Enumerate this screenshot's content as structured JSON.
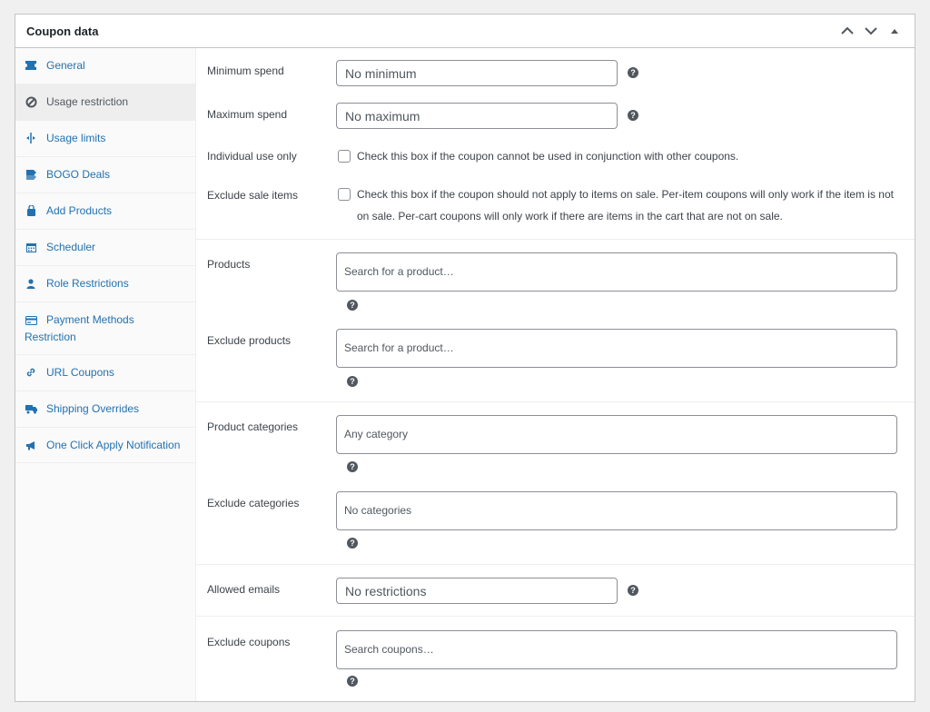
{
  "metabox": {
    "title": "Coupon data"
  },
  "tabs": [
    {
      "label": "General",
      "icon": "ticket-icon"
    },
    {
      "label": "Usage restriction",
      "icon": "prohibited-icon"
    },
    {
      "label": "Usage limits",
      "icon": "arrows-limit-icon"
    },
    {
      "label": "BOGO Deals",
      "icon": "bogo-icon"
    },
    {
      "label": "Add Products",
      "icon": "bag-icon"
    },
    {
      "label": "Scheduler",
      "icon": "calendar-icon"
    },
    {
      "label": "Role Restrictions",
      "icon": "user-icon"
    },
    {
      "label": "Payment Methods Restriction",
      "icon": "credit-card-icon"
    },
    {
      "label": "URL Coupons",
      "icon": "link-icon"
    },
    {
      "label": "Shipping Overrides",
      "icon": "truck-icon"
    },
    {
      "label": "One Click Apply Notification",
      "icon": "megaphone-icon"
    }
  ],
  "fields": {
    "minimum_spend": {
      "label": "Minimum spend",
      "placeholder": "No minimum"
    },
    "maximum_spend": {
      "label": "Maximum spend",
      "placeholder": "No maximum"
    },
    "individual_use": {
      "label": "Individual use only",
      "description": "Check this box if the coupon cannot be used in conjunction with other coupons."
    },
    "exclude_sale": {
      "label": "Exclude sale items",
      "description": "Check this box if the coupon should not apply to items on sale. Per-item coupons will only work if the item is not on sale. Per-cart coupons will only work if there are items in the cart that are not on sale."
    },
    "products": {
      "label": "Products",
      "placeholder": "Search for a product…"
    },
    "exclude_products": {
      "label": "Exclude products",
      "placeholder": "Search for a product…"
    },
    "product_categories": {
      "label": "Product categories",
      "placeholder": "Any category"
    },
    "exclude_categories": {
      "label": "Exclude categories",
      "placeholder": "No categories"
    },
    "allowed_emails": {
      "label": "Allowed emails",
      "placeholder": "No restrictions"
    },
    "exclude_coupons": {
      "label": "Exclude coupons",
      "placeholder": "Search coupons…"
    }
  },
  "help_glyph": "?",
  "colors": {
    "link": "#2271b1",
    "active_tab_bg": "#eeeeee",
    "border": "#c3c4c7"
  }
}
